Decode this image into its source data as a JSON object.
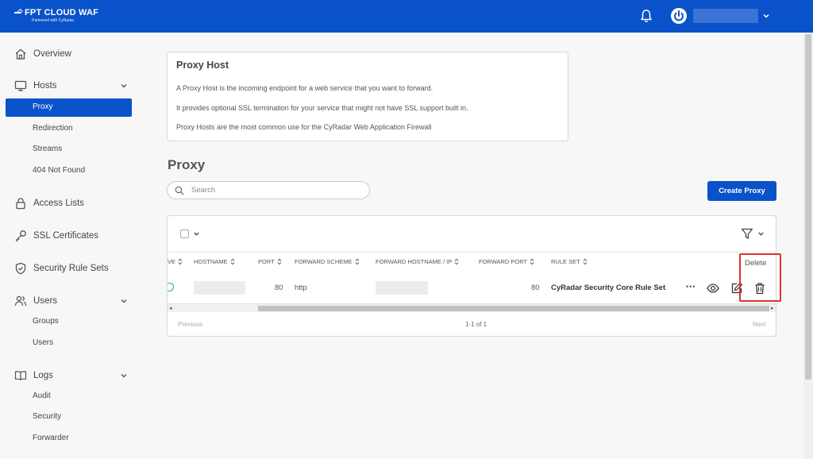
{
  "app": {
    "logo_text": "FPT CLOUD WAF",
    "logo_tagline": "Partnered with CyRadar"
  },
  "sidebar": {
    "overview": "Overview",
    "hosts": "Hosts",
    "hosts_items": [
      "Proxy",
      "Redirection",
      "Streams",
      "404 Not Found"
    ],
    "access_lists": "Access Lists",
    "ssl": "SSL Certificates",
    "rule_sets": "Security Rule Sets",
    "users": "Users",
    "users_items": [
      "Groups",
      "Users"
    ],
    "logs": "Logs",
    "logs_items": [
      "Audit",
      "Security",
      "Forwarder"
    ],
    "active_item": "Proxy"
  },
  "info": {
    "title": "Proxy Host",
    "lines": [
      "A Proxy Host is the incoming endpoint for a web service that you want to forward.",
      "It provides optional SSL termination for your service that might not have SSL support built in.",
      "Proxy Hosts are the most common use for the CyRadar Web Application Firewall"
    ]
  },
  "main": {
    "title": "Proxy",
    "search_placeholder": "Search",
    "create_button": "Create Proxy"
  },
  "table": {
    "columns": [
      "VE",
      "HOSTNAME",
      "PORT",
      "FORWARD SCHEME",
      "FORWARD HOSTNAME / IP",
      "FORWARD PORT",
      "RULE SET"
    ],
    "row": {
      "port": "80",
      "scheme": "http",
      "forward_port": "80",
      "rule_set": "CyRadar Security Core Rule Set",
      "status": "active"
    },
    "more": "•••",
    "scroll_left": "◂",
    "scroll_right": "▸",
    "pager": {
      "prev": "Previous",
      "info": "1-1 of 1",
      "next": "Next"
    }
  },
  "tooltip": {
    "delete": "Delete"
  },
  "colors": {
    "brand": "#0a52c9",
    "highlight": "#d9352b",
    "success": "#27ae60"
  }
}
